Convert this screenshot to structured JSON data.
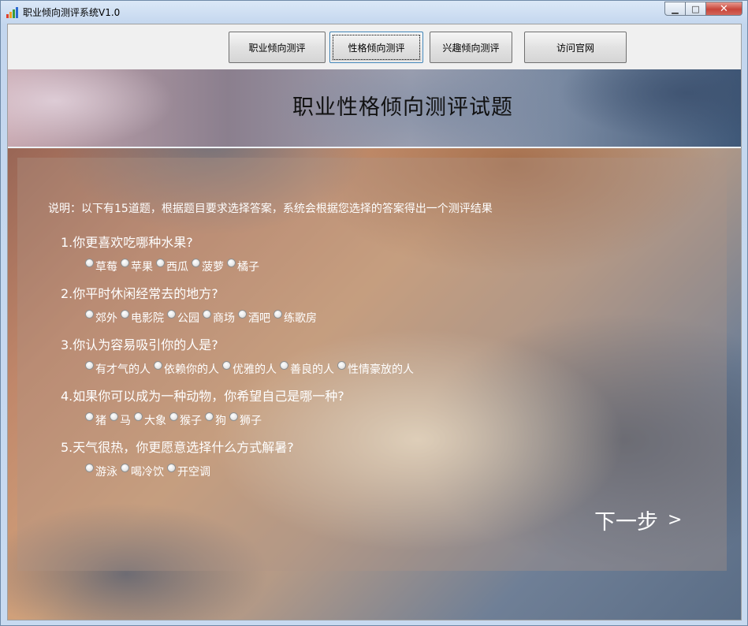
{
  "window": {
    "title": "职业倾向测评系统V1.0",
    "icon": "bar-chart-icon",
    "controls": {
      "minimize": "▁",
      "maximize": "□",
      "close": "✕"
    }
  },
  "toolbar": {
    "buttons": [
      {
        "label": "职业倾向测评",
        "active": false
      },
      {
        "label": "性格倾向测评",
        "active": true
      },
      {
        "label": "兴趣倾向测评",
        "active": false
      },
      {
        "label": "访问官网",
        "active": false
      }
    ]
  },
  "page": {
    "title": "职业性格倾向测评试题",
    "instruction": "说明：以下有15道题，根据题目要求选择答案，系统会根据您选择的答案得出一个测评结果",
    "next_label": "下一步",
    "next_arrow": ">"
  },
  "questions": [
    {
      "text": "1.你更喜欢吃哪种水果?",
      "options": [
        "草莓",
        "苹果",
        "西瓜",
        "菠萝",
        "橘子"
      ]
    },
    {
      "text": "2.你平时休闲经常去的地方?",
      "options": [
        "郊外",
        "电影院",
        "公园",
        "商场",
        "酒吧",
        "练歌房"
      ]
    },
    {
      "text": "3.你认为容易吸引你的人是?",
      "options": [
        "有才气的人",
        "依赖你的人",
        "优雅的人",
        "善良的人",
        "性情豪放的人"
      ]
    },
    {
      "text": "4.如果你可以成为一种动物，你希望自己是哪一种?",
      "options": [
        "猪",
        "马",
        "大象",
        "猴子",
        "狗",
        "狮子"
      ]
    },
    {
      "text": "5.天气很热，你更愿意选择什么方式解暑?",
      "options": [
        "游泳",
        "喝冷饮",
        "开空调"
      ]
    }
  ]
}
